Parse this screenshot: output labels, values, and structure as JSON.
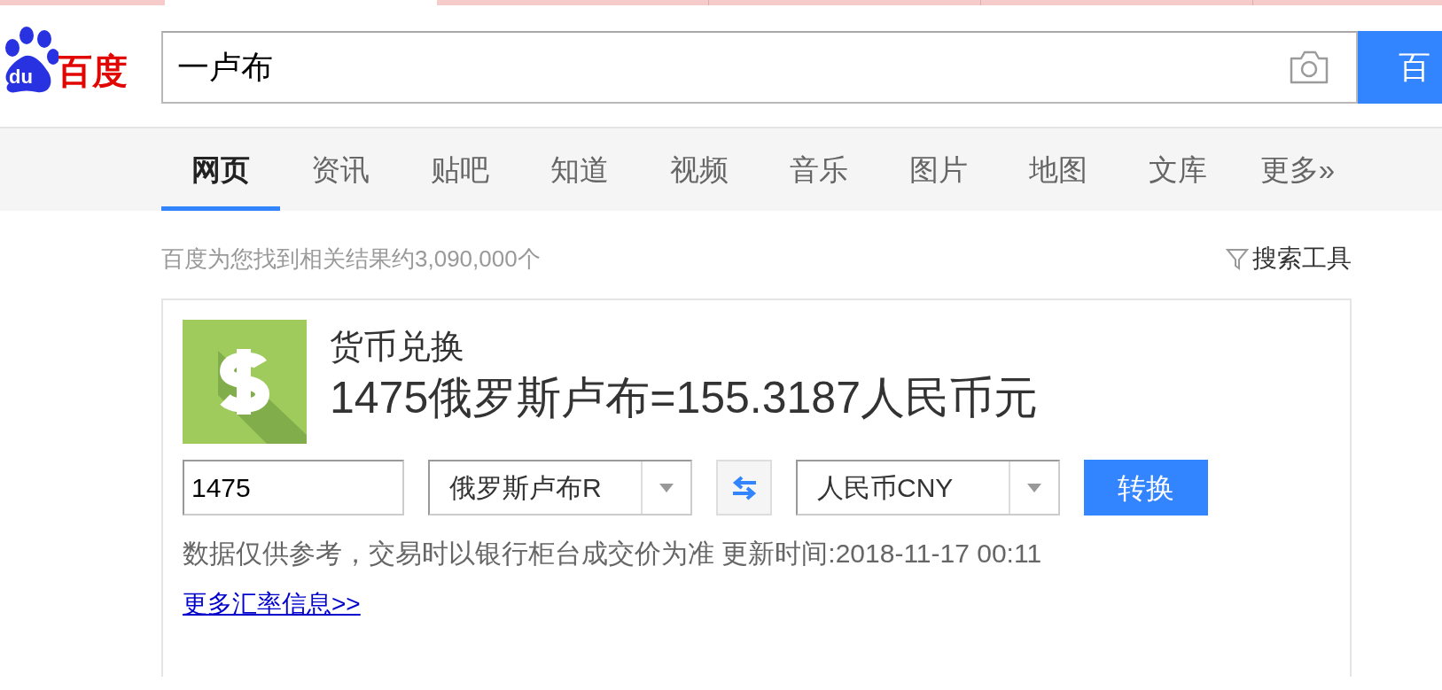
{
  "logo": {
    "mark_text": "du",
    "text": "百度"
  },
  "search": {
    "value": "一卢布",
    "button": "百"
  },
  "nav_tabs": [
    {
      "label": "网页",
      "selected": true
    },
    {
      "label": "资讯",
      "selected": false
    },
    {
      "label": "贴吧",
      "selected": false
    },
    {
      "label": "知道",
      "selected": false
    },
    {
      "label": "视频",
      "selected": false
    },
    {
      "label": "音乐",
      "selected": false
    },
    {
      "label": "图片",
      "selected": false
    },
    {
      "label": "地图",
      "selected": false
    },
    {
      "label": "文库",
      "selected": false
    },
    {
      "label": "更多»",
      "selected": false
    }
  ],
  "result_count": "百度为您找到相关结果约3,090,000个",
  "search_tools": "搜索工具",
  "converter": {
    "title": "货币兑换",
    "result": "1475俄罗斯卢布=155.3187人民币元",
    "amount": "1475",
    "from_currency": "俄罗斯卢布R",
    "to_currency": "人民币CNY",
    "convert_button": "转换",
    "note": "数据仅供参考，交易时以银行柜台成交价为准 更新时间:2018-11-17 00:11",
    "more_link": "更多汇率信息>>"
  }
}
